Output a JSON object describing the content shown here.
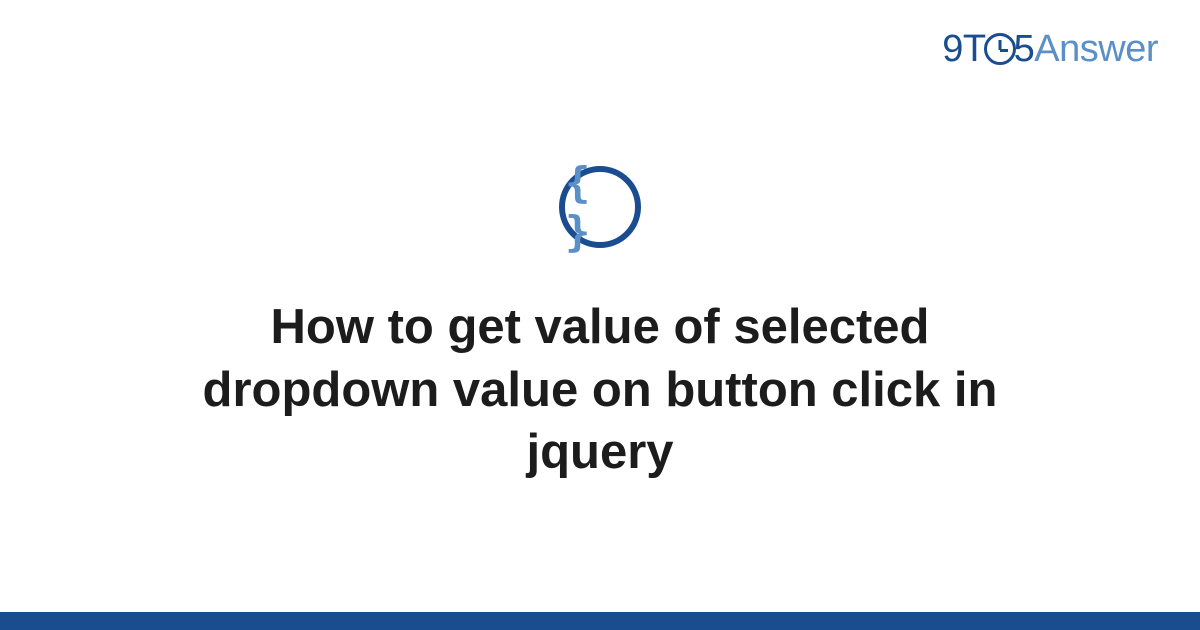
{
  "logo": {
    "part1": "9T",
    "part2": "5",
    "part3": "Answer"
  },
  "category": {
    "icon_name": "braces-icon",
    "icon_glyph": "{ }"
  },
  "title": "How to get value of selected dropdown value on button click in jquery",
  "colors": {
    "brand_dark": "#1a4d8f",
    "brand_light": "#5b8fc7"
  }
}
